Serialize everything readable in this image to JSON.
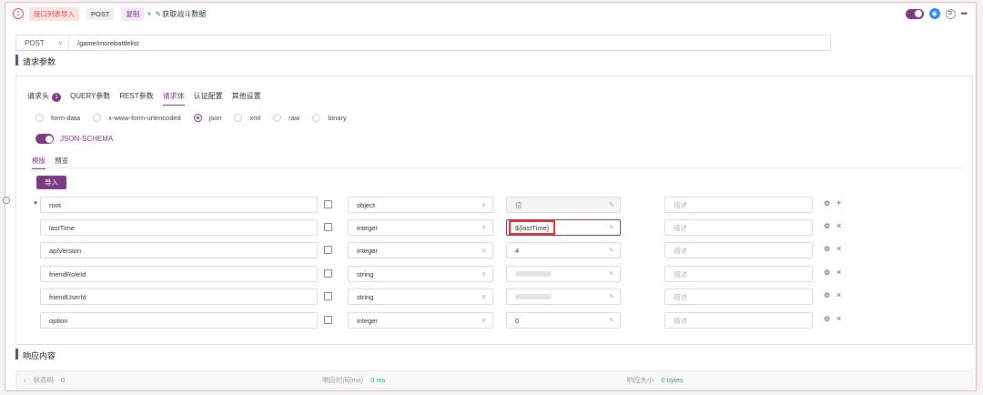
{
  "header": {
    "index": "1",
    "tag_label": "接口列表导入",
    "method": "POST",
    "copy_label": "复制",
    "title": "获取战斗数据"
  },
  "url": {
    "method": "POST",
    "path": "/game/morebattlelist"
  },
  "request_section": {
    "title": "请求参数"
  },
  "tabs": [
    {
      "label": "请求头",
      "badge": "1"
    },
    {
      "label": "QUERY参数"
    },
    {
      "label": "REST参数"
    },
    {
      "label": "请求体",
      "active": true
    },
    {
      "label": "认证配置"
    },
    {
      "label": "其他设置"
    }
  ],
  "body_types": [
    {
      "label": "form-data",
      "selected": false
    },
    {
      "label": "x-www-form-urlencoded",
      "selected": false
    },
    {
      "label": "json",
      "selected": true
    },
    {
      "label": "xml",
      "selected": false
    },
    {
      "label": "raw",
      "selected": false
    },
    {
      "label": "binary",
      "selected": false
    }
  ],
  "schema_toggle": {
    "label": "JSON-SCHEMA",
    "on": true
  },
  "subtabs": [
    {
      "label": "模版",
      "active": true
    },
    {
      "label": "预览"
    }
  ],
  "import_label": "导入",
  "rows": [
    {
      "name": "root",
      "type": "object",
      "value": "值",
      "desc": "描述",
      "action": "+"
    },
    {
      "name": "lastTime",
      "type": "integer",
      "value": "${lastTime}",
      "desc": "描述",
      "action": "×"
    },
    {
      "name": "apiVersion",
      "type": "integer",
      "value": "4",
      "desc": "描述",
      "action": "×"
    },
    {
      "name": "friendRoleId",
      "type": "string",
      "value": "",
      "desc": "描述",
      "action": "×"
    },
    {
      "name": "friendUserId",
      "type": "string",
      "value": "",
      "desc": "描述",
      "action": "×"
    },
    {
      "name": "option",
      "type": "integer",
      "value": "0",
      "desc": "描述",
      "action": "×"
    }
  ],
  "response_section": {
    "title": "响应内容"
  },
  "response": {
    "status_label": "状态码",
    "status_value": "0",
    "time_label": "响应时间(ms)",
    "time_value": "0 ms",
    "size_label": "响应大小",
    "size_value": "0 bytes"
  },
  "colors": {
    "accent": "#7a3b82",
    "highlight": "#e5332a",
    "success": "#3ca55c"
  }
}
